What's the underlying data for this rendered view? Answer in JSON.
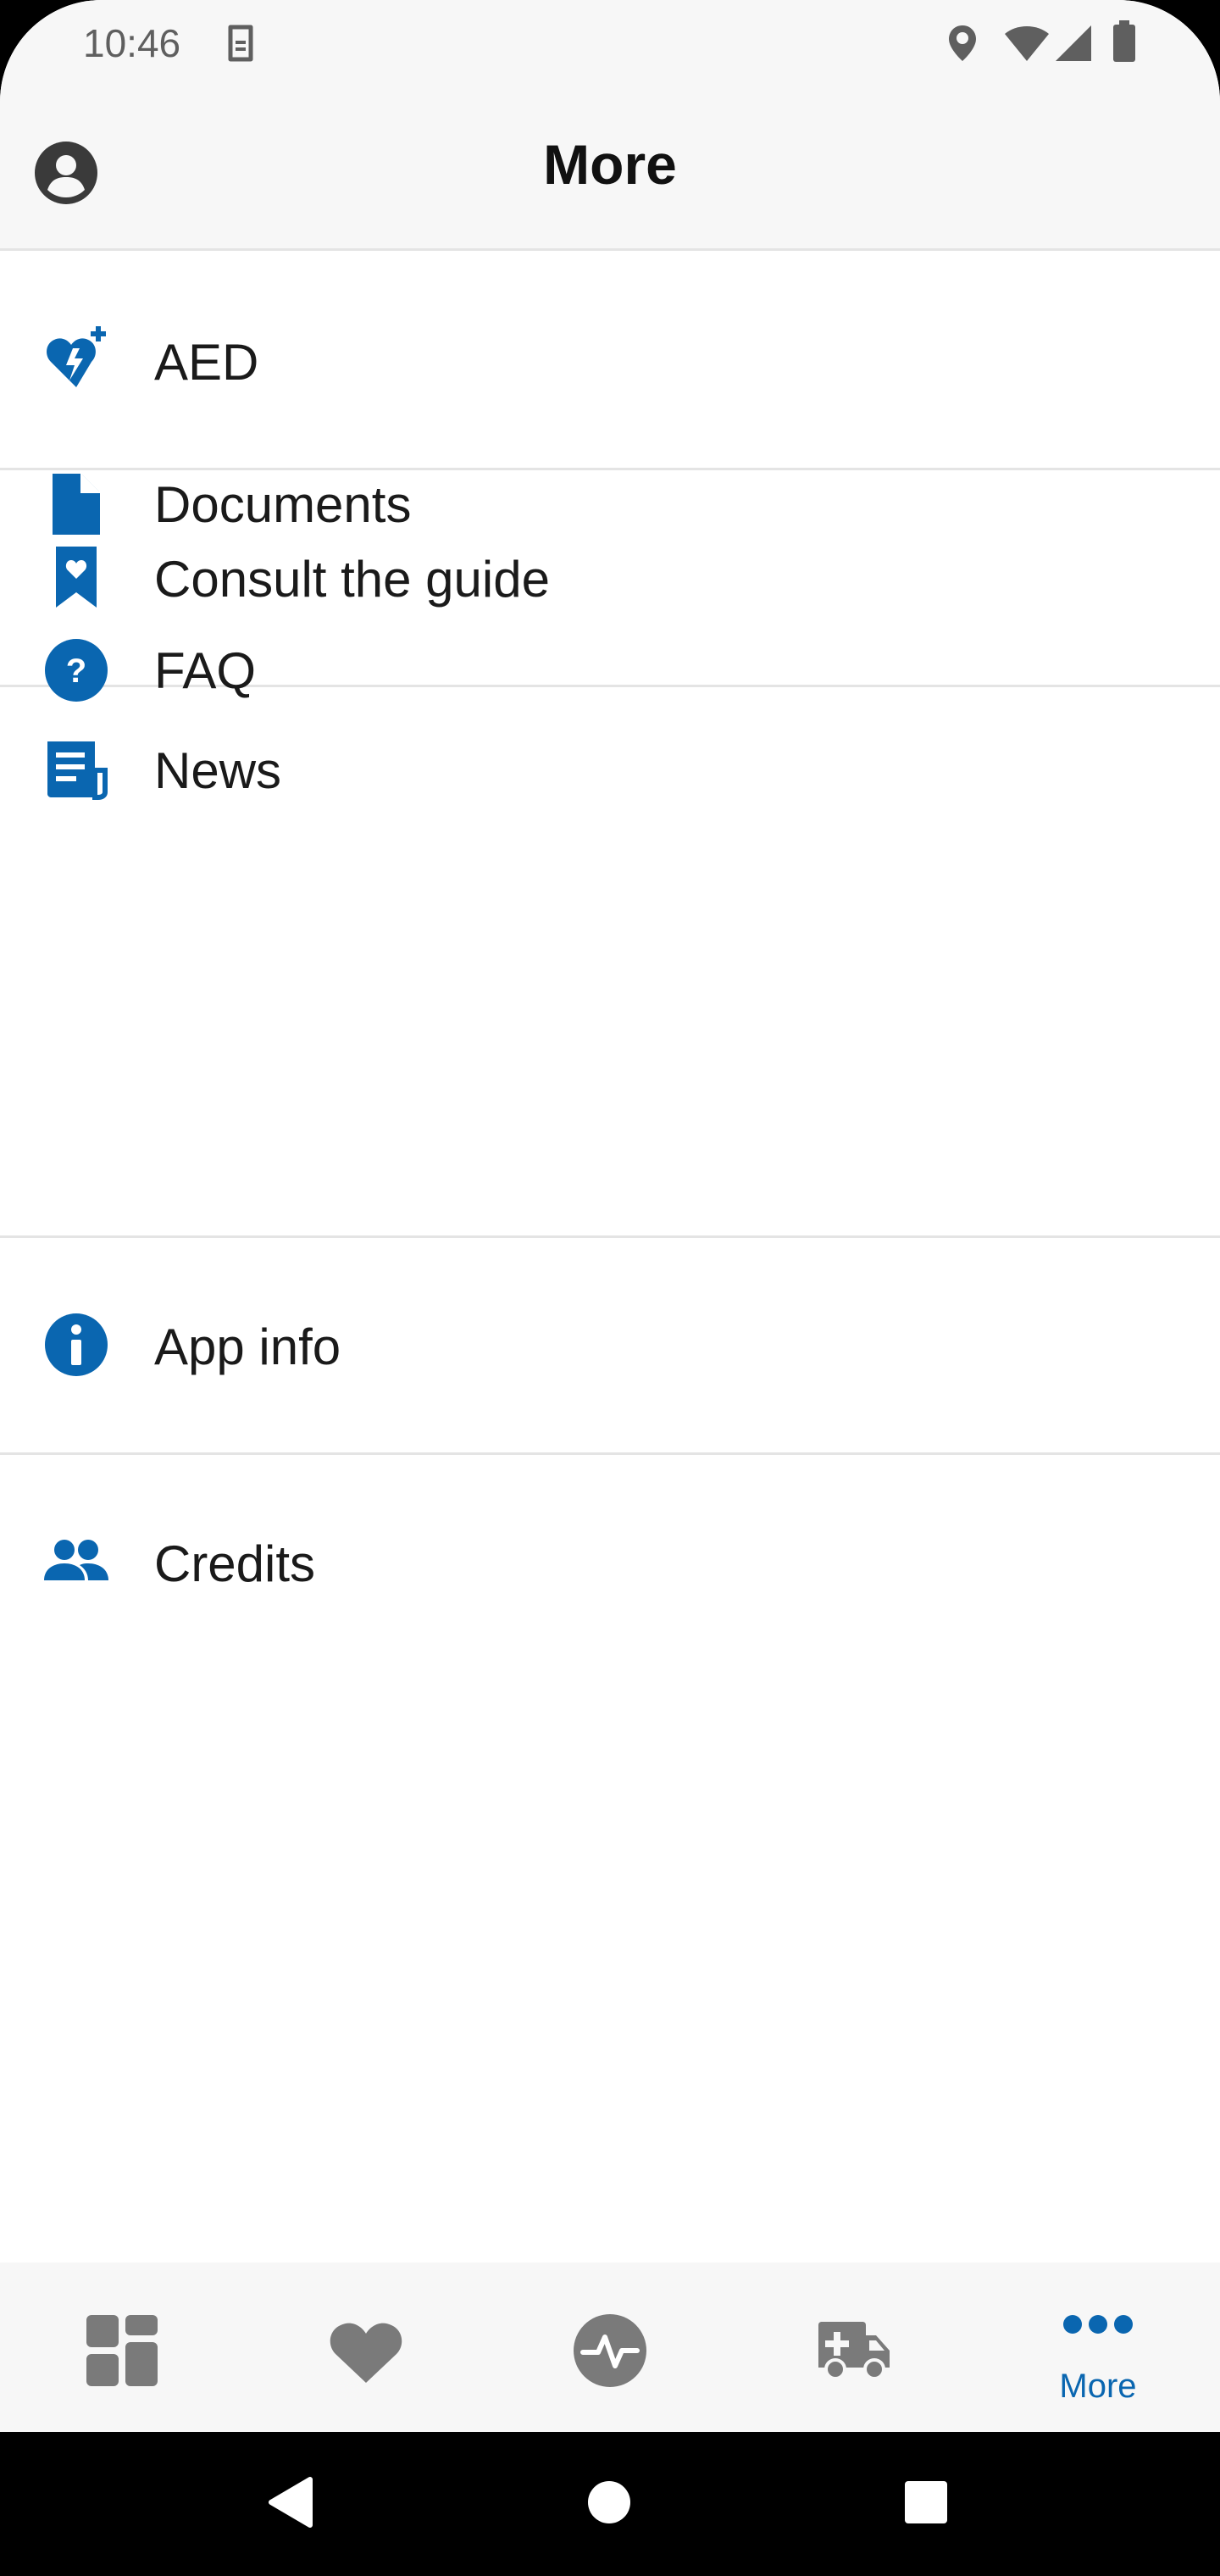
{
  "status_bar": {
    "time": "10:46",
    "icons": [
      "sim-card-icon",
      "location-icon",
      "wifi-icon",
      "signal-icon",
      "battery-icon"
    ]
  },
  "header": {
    "title": "More",
    "profile_icon": "account-circle-icon"
  },
  "menu": {
    "groups": [
      {
        "items": [
          {
            "label": "AED",
            "icon": "aed-heart-icon"
          }
        ]
      },
      {
        "items": [
          {
            "label": "Consult the guide",
            "icon": "bookmark-heart-icon"
          }
        ]
      },
      {
        "items": [
          {
            "label": "News",
            "icon": "newspaper-icon"
          },
          {
            "label": "Documents",
            "icon": "document-icon"
          },
          {
            "label": "FAQ",
            "icon": "help-circle-icon"
          }
        ]
      },
      {
        "items": [
          {
            "label": "App info",
            "icon": "info-circle-icon"
          }
        ]
      },
      {
        "items": [
          {
            "label": "Credits",
            "icon": "people-icon"
          }
        ]
      }
    ]
  },
  "bottom_nav": {
    "items": [
      {
        "icon": "dashboard-icon",
        "label": ""
      },
      {
        "icon": "heart-icon",
        "label": ""
      },
      {
        "icon": "pulse-icon",
        "label": ""
      },
      {
        "icon": "ambulance-icon",
        "label": ""
      },
      {
        "icon": "more-dots-icon",
        "label": "More",
        "active": true
      }
    ]
  },
  "colors": {
    "accent": "#0a66b0",
    "inactive_icon": "#7a7a7a",
    "bar_background": "#f7f7f7"
  }
}
